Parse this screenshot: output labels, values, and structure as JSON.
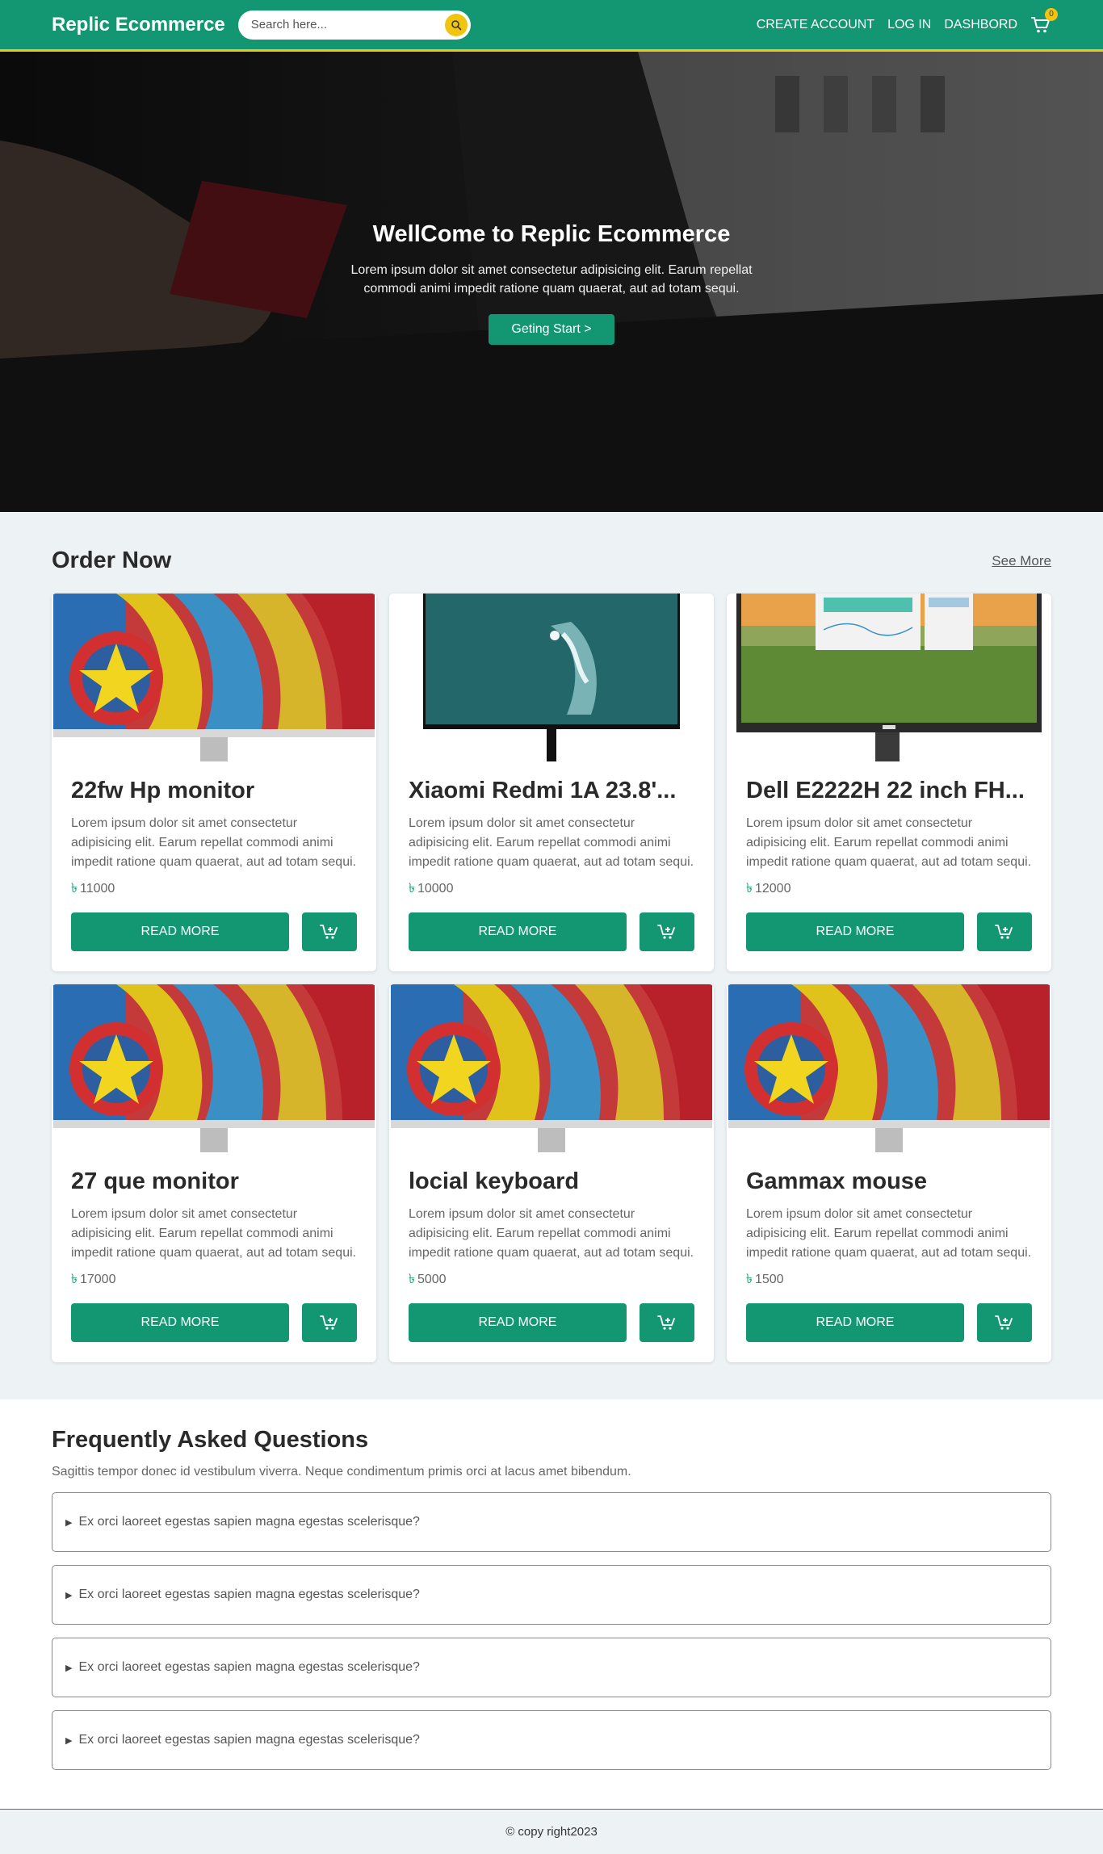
{
  "navbar": {
    "brand": "Replic Ecommerce",
    "search_placeholder": "Search here...",
    "links": [
      "CREATE ACCOUNT",
      "LOG IN",
      "DASHBORD"
    ],
    "cart_count": "0"
  },
  "hero": {
    "title": "WellCome to Replic Ecommerce",
    "subtitle": "Lorem ipsum dolor sit amet consectetur adipisicing elit. Earum repellat commodi animi impedit ratione quam quaerat, aut ad totam sequi.",
    "button": "Geting Start >"
  },
  "products": {
    "title": "Order Now",
    "see_more": "See More",
    "read_more": "READ MORE",
    "currency": "৳",
    "items": [
      {
        "name": "22fw Hp monitor",
        "desc": "Lorem ipsum dolor sit amet consectetur adipisicing elit. Earum repellat commodi animi impedit ratione quam quaerat, aut ad totam sequi.",
        "price": "11000"
      },
      {
        "name": "Xiaomi Redmi 1A 23.8'...",
        "desc": "Lorem ipsum dolor sit amet consectetur adipisicing elit. Earum repellat commodi animi impedit ratione quam quaerat, aut ad totam sequi.",
        "price": "10000"
      },
      {
        "name": "Dell E2222H 22 inch FH...",
        "desc": "Lorem ipsum dolor sit amet consectetur adipisicing elit. Earum repellat commodi animi impedit ratione quam quaerat, aut ad totam sequi.",
        "price": "12000"
      },
      {
        "name": "27 que monitor",
        "desc": "Lorem ipsum dolor sit amet consectetur adipisicing elit. Earum repellat commodi animi impedit ratione quam quaerat, aut ad totam sequi.",
        "price": "17000"
      },
      {
        "name": "locial keyboard",
        "desc": "Lorem ipsum dolor sit amet consectetur adipisicing elit. Earum repellat commodi animi impedit ratione quam quaerat, aut ad totam sequi.",
        "price": "5000"
      },
      {
        "name": "Gammax mouse",
        "desc": "Lorem ipsum dolor sit amet consectetur adipisicing elit. Earum repellat commodi animi impedit ratione quam quaerat, aut ad totam sequi.",
        "price": "1500"
      }
    ]
  },
  "faq": {
    "title": "Frequently Asked Questions",
    "subtitle": "Sagittis tempor donec id vestibulum viverra. Neque condimentum primis orci at lacus amet bibendum.",
    "items": [
      "Ex orci laoreet egestas sapien magna egestas scelerisque?",
      "Ex orci laoreet egestas sapien magna egestas scelerisque?",
      "Ex orci laoreet egestas sapien magna egestas scelerisque?",
      "Ex orci laoreet egestas sapien magna egestas scelerisque?"
    ]
  },
  "footer": {
    "text": "© copy right2023"
  },
  "colors": {
    "primary": "#139672",
    "accent": "#f1c40f",
    "section_bg": "#edf2f5"
  },
  "icons": {
    "search": "search-icon",
    "cart": "cart-icon",
    "add_cart": "cart-plus-icon",
    "faq": "triangle-right-icon"
  }
}
